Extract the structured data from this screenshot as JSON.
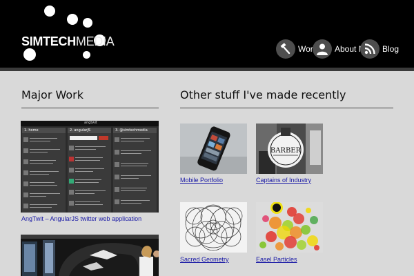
{
  "brand": {
    "logo_bold": "SIMTECH",
    "logo_light": "MEDIA"
  },
  "nav": [
    {
      "label": "Work",
      "icon": "hammer-icon"
    },
    {
      "label": "About Me",
      "icon": "person-icon"
    },
    {
      "label": "Blog",
      "icon": "rss-icon"
    }
  ],
  "major": {
    "heading": "Major Work",
    "items": [
      {
        "caption": "AngTwit – AngularJS twitter web application"
      }
    ]
  },
  "other": {
    "heading": "Other stuff I've made recently",
    "items": [
      {
        "caption": "Mobile Portfolio"
      },
      {
        "caption": "Captains of Industry"
      },
      {
        "caption": "Sacred Geometry"
      },
      {
        "caption": "Easel Particles"
      }
    ]
  },
  "angtwit_shot": {
    "app_title": "angtwit",
    "columns": [
      "1. home",
      "2. angularJS",
      "3. @simtechmedia"
    ]
  },
  "barber_shot": {
    "sign_text": "BARBER"
  },
  "colors": {
    "header_bg": "#000000",
    "page_bg": "#d9d9d9",
    "link": "#1a1aa6"
  }
}
